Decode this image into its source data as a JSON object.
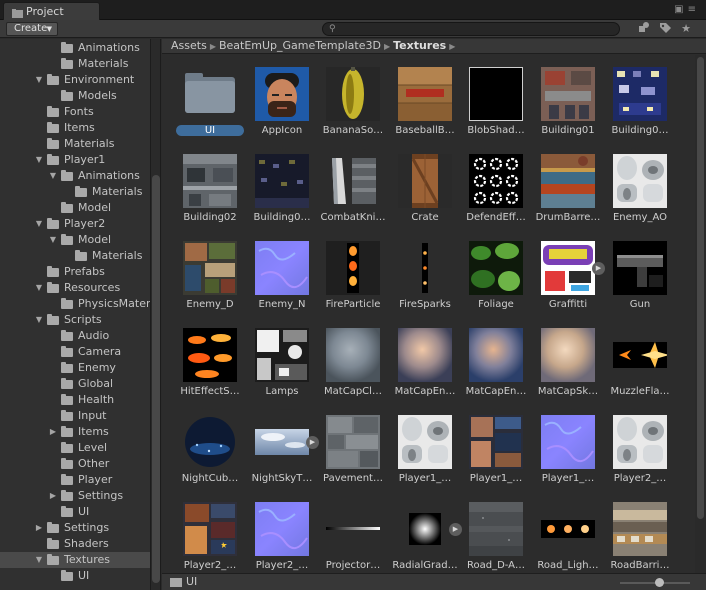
{
  "window": {
    "tab_title": "Project"
  },
  "toolbar": {
    "create_label": "Create",
    "search_placeholder": ""
  },
  "icons": {
    "tab": "folder-icon",
    "search": "search-icon",
    "lock": "lock-icon",
    "menu": "menu-icon",
    "filter_type": "filter-by-type-icon",
    "filter_label": "filter-by-label-icon",
    "favorite": "star-icon"
  },
  "tree": [
    {
      "label": "Animations",
      "depth": 2,
      "arrow": "none"
    },
    {
      "label": "Materials",
      "depth": 2,
      "arrow": "none"
    },
    {
      "label": "Environment",
      "depth": 1,
      "arrow": "down"
    },
    {
      "label": "Models",
      "depth": 2,
      "arrow": "none"
    },
    {
      "label": "Fonts",
      "depth": 1,
      "arrow": "none"
    },
    {
      "label": "Items",
      "depth": 1,
      "arrow": "none"
    },
    {
      "label": "Materials",
      "depth": 1,
      "arrow": "none"
    },
    {
      "label": "Player1",
      "depth": 1,
      "arrow": "down"
    },
    {
      "label": "Animations",
      "depth": 2,
      "arrow": "down"
    },
    {
      "label": "Materials",
      "depth": 3,
      "arrow": "none"
    },
    {
      "label": "Model",
      "depth": 2,
      "arrow": "none"
    },
    {
      "label": "Player2",
      "depth": 1,
      "arrow": "down"
    },
    {
      "label": "Model",
      "depth": 2,
      "arrow": "down"
    },
    {
      "label": "Materials",
      "depth": 3,
      "arrow": "none"
    },
    {
      "label": "Prefabs",
      "depth": 1,
      "arrow": "none"
    },
    {
      "label": "Resources",
      "depth": 1,
      "arrow": "down"
    },
    {
      "label": "PhysicsMaterials",
      "depth": 2,
      "arrow": "none"
    },
    {
      "label": "Scripts",
      "depth": 1,
      "arrow": "down"
    },
    {
      "label": "Audio",
      "depth": 2,
      "arrow": "none"
    },
    {
      "label": "Camera",
      "depth": 2,
      "arrow": "none"
    },
    {
      "label": "Enemy",
      "depth": 2,
      "arrow": "none"
    },
    {
      "label": "Global",
      "depth": 2,
      "arrow": "none"
    },
    {
      "label": "Health",
      "depth": 2,
      "arrow": "none"
    },
    {
      "label": "Input",
      "depth": 2,
      "arrow": "none"
    },
    {
      "label": "Items",
      "depth": 2,
      "arrow": "right"
    },
    {
      "label": "Level",
      "depth": 2,
      "arrow": "none"
    },
    {
      "label": "Other",
      "depth": 2,
      "arrow": "none"
    },
    {
      "label": "Player",
      "depth": 2,
      "arrow": "none"
    },
    {
      "label": "Settings",
      "depth": 2,
      "arrow": "right"
    },
    {
      "label": "UI",
      "depth": 2,
      "arrow": "none"
    },
    {
      "label": "Settings",
      "depth": 1,
      "arrow": "right"
    },
    {
      "label": "Shaders",
      "depth": 1,
      "arrow": "none"
    },
    {
      "label": "Textures",
      "depth": 1,
      "arrow": "down",
      "selected": true
    },
    {
      "label": "UI",
      "depth": 2,
      "arrow": "none"
    }
  ],
  "breadcrumb": {
    "items": [
      "Assets",
      "BeatEmUp_GameTemplate3D",
      "Textures"
    ]
  },
  "assets": [
    {
      "label": "UI",
      "kind": "folder",
      "selected": true
    },
    {
      "label": "AppIcon",
      "kind": "portrait"
    },
    {
      "label": "BananaSo…",
      "kind": "banana"
    },
    {
      "label": "BaseballB…",
      "kind": "wood"
    },
    {
      "label": "BlobShad…",
      "kind": "black"
    },
    {
      "label": "Building01",
      "kind": "building-red"
    },
    {
      "label": "Building0…",
      "kind": "building-blue"
    },
    {
      "label": "Building02",
      "kind": "building-gray"
    },
    {
      "label": "Building0…",
      "kind": "building-night"
    },
    {
      "label": "CombatKni…",
      "kind": "knife"
    },
    {
      "label": "Crate",
      "kind": "crate"
    },
    {
      "label": "DefendEff…",
      "kind": "rings"
    },
    {
      "label": "DrumBarre…",
      "kind": "barrels"
    },
    {
      "label": "Enemy_AO",
      "kind": "ao"
    },
    {
      "label": "Enemy_D",
      "kind": "enemy"
    },
    {
      "label": "Enemy_N",
      "kind": "normal"
    },
    {
      "label": "FireParticle",
      "kind": "fire"
    },
    {
      "label": "FireSparks",
      "kind": "sparks"
    },
    {
      "label": "Foliage",
      "kind": "foliage"
    },
    {
      "label": "Graffitti",
      "kind": "graffiti",
      "expand": true
    },
    {
      "label": "Gun",
      "kind": "gun"
    },
    {
      "label": "HitEffectS…",
      "kind": "hit"
    },
    {
      "label": "Lamps",
      "kind": "lamps"
    },
    {
      "label": "MatCapCl…",
      "kind": "matcap-gray"
    },
    {
      "label": "MatCapEn…",
      "kind": "matcap-warm"
    },
    {
      "label": "MatCapEn…",
      "kind": "matcap-blue"
    },
    {
      "label": "MatCapSk…",
      "kind": "matcap-skin"
    },
    {
      "label": "MuzzleFla…",
      "kind": "muzzle"
    },
    {
      "label": "NightCub…",
      "kind": "nightcube"
    },
    {
      "label": "NightSkyT…",
      "kind": "sky",
      "expand": true
    },
    {
      "label": "Pavement…",
      "kind": "pavement"
    },
    {
      "label": "Player1_…",
      "kind": "ao"
    },
    {
      "label": "Player1_…",
      "kind": "player1d"
    },
    {
      "label": "Player1_…",
      "kind": "normal"
    },
    {
      "label": "Player2_…",
      "kind": "ao"
    },
    {
      "label": "Player2_…",
      "kind": "player2d"
    },
    {
      "label": "Player2_…",
      "kind": "normal"
    },
    {
      "label": "Projector…",
      "kind": "projector"
    },
    {
      "label": "RadialGrad…",
      "kind": "radial",
      "expand": true
    },
    {
      "label": "Road_D-A…",
      "kind": "road"
    },
    {
      "label": "Road_Ligh…",
      "kind": "roadlight"
    },
    {
      "label": "RoadBarri…",
      "kind": "barrier"
    }
  ],
  "status": {
    "selected_path": "UI"
  }
}
